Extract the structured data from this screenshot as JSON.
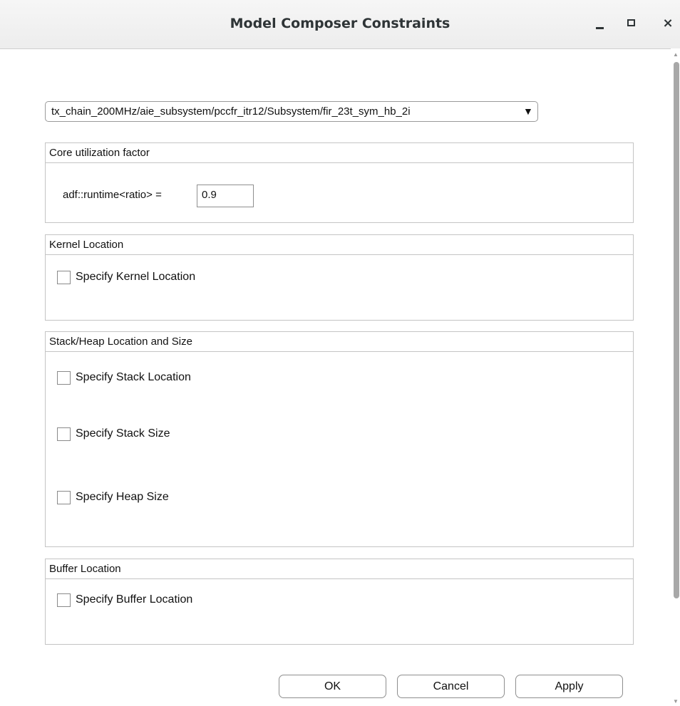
{
  "window": {
    "title": "Model Composer Constraints",
    "controls": {
      "minimize": "minimize",
      "maximize": "maximize",
      "close": "×"
    }
  },
  "block_selector": {
    "selected": "tx_chain_200MHz/aie_subsystem/pccfr_itr12/Subsystem/fir_23t_sym_hb_2i",
    "arrow": "▼"
  },
  "core_utilization": {
    "title": "Core utilization factor",
    "field_label": "adf::runtime<ratio> =",
    "field_value": "0.9"
  },
  "kernel_location": {
    "title": "Kernel Location",
    "specify_kernel_location": {
      "label": "Specify Kernel Location",
      "checked": false
    }
  },
  "stack_heap": {
    "title": "Stack/Heap Location and Size",
    "specify_stack_location": {
      "label": "Specify Stack Location",
      "checked": false
    },
    "specify_stack_size": {
      "label": "Specify Stack Size",
      "checked": false
    },
    "specify_heap_size": {
      "label": "Specify Heap Size",
      "checked": false
    }
  },
  "buffer_location": {
    "title": "Buffer Location",
    "specify_buffer_location": {
      "label": "Specify Buffer Location",
      "checked": false
    }
  },
  "buttons": {
    "ok": "OK",
    "cancel": "Cancel",
    "apply": "Apply"
  },
  "scrollbar": {
    "up_arrow": "▲",
    "down_arrow": "▼"
  }
}
